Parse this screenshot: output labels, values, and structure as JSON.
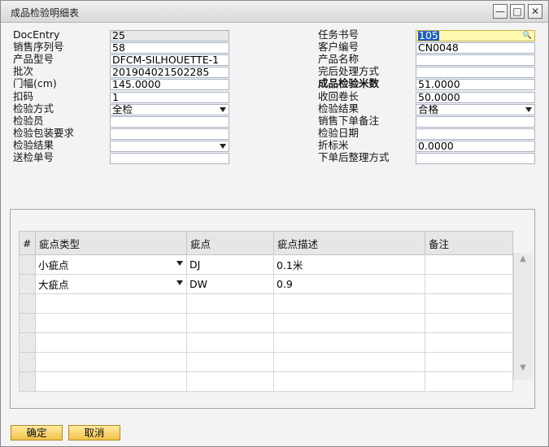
{
  "window": {
    "title": "成品检验明细表"
  },
  "left_form": [
    {
      "label": "DocEntry",
      "value": "25",
      "readonly": true
    },
    {
      "label": "销售序列号",
      "value": "58"
    },
    {
      "label": "产品型号",
      "value": "DFCM-SILHOUETTE-1"
    },
    {
      "label": "批次",
      "value": "201904021502285"
    },
    {
      "label": "门幅(cm)",
      "value": "145.0000"
    },
    {
      "label": "扣码",
      "value": "1"
    },
    {
      "label": "检验方式",
      "value": "全检",
      "dropdown": true
    },
    {
      "label": "检验员",
      "value": ""
    },
    {
      "label": "检验包装要求",
      "value": ""
    },
    {
      "label": "检验结果",
      "value": "",
      "dropdown": true
    },
    {
      "label": "送检单号",
      "value": ""
    }
  ],
  "right_form": [
    {
      "label": "任务书号",
      "value": "105",
      "active": true
    },
    {
      "label": "客户编号",
      "value": "CN0048"
    },
    {
      "label": "产品名称",
      "value": ""
    },
    {
      "label": "完后处理方式",
      "value": ""
    },
    {
      "label": "成品检验米数",
      "value": "51.0000",
      "bold": true
    },
    {
      "label": "收回卷长",
      "value": "50.0000"
    },
    {
      "label": "检验结果",
      "value": "合格",
      "dropdown": true
    },
    {
      "label": "销售下单备注",
      "value": ""
    },
    {
      "label": "检验日期",
      "value": ""
    },
    {
      "label": "折标米",
      "value": "0.0000"
    },
    {
      "label": "下单后整理方式",
      "value": ""
    }
  ],
  "grid": {
    "columns": [
      "#",
      "疵点类型",
      "疵点",
      "疵点描述",
      "备注"
    ],
    "rows": [
      {
        "type": "小疵点",
        "point": "DJ",
        "desc": "0.1米",
        "note": ""
      },
      {
        "type": "大疵点",
        "point": "DW",
        "desc": "0.9",
        "note": ""
      }
    ]
  },
  "buttons": {
    "ok": "确定",
    "cancel": "取消"
  },
  "titlebar_buttons": {
    "minimize": "—",
    "maximize": "□",
    "close": "✕"
  },
  "icons": {
    "lookup": "search-icon"
  }
}
